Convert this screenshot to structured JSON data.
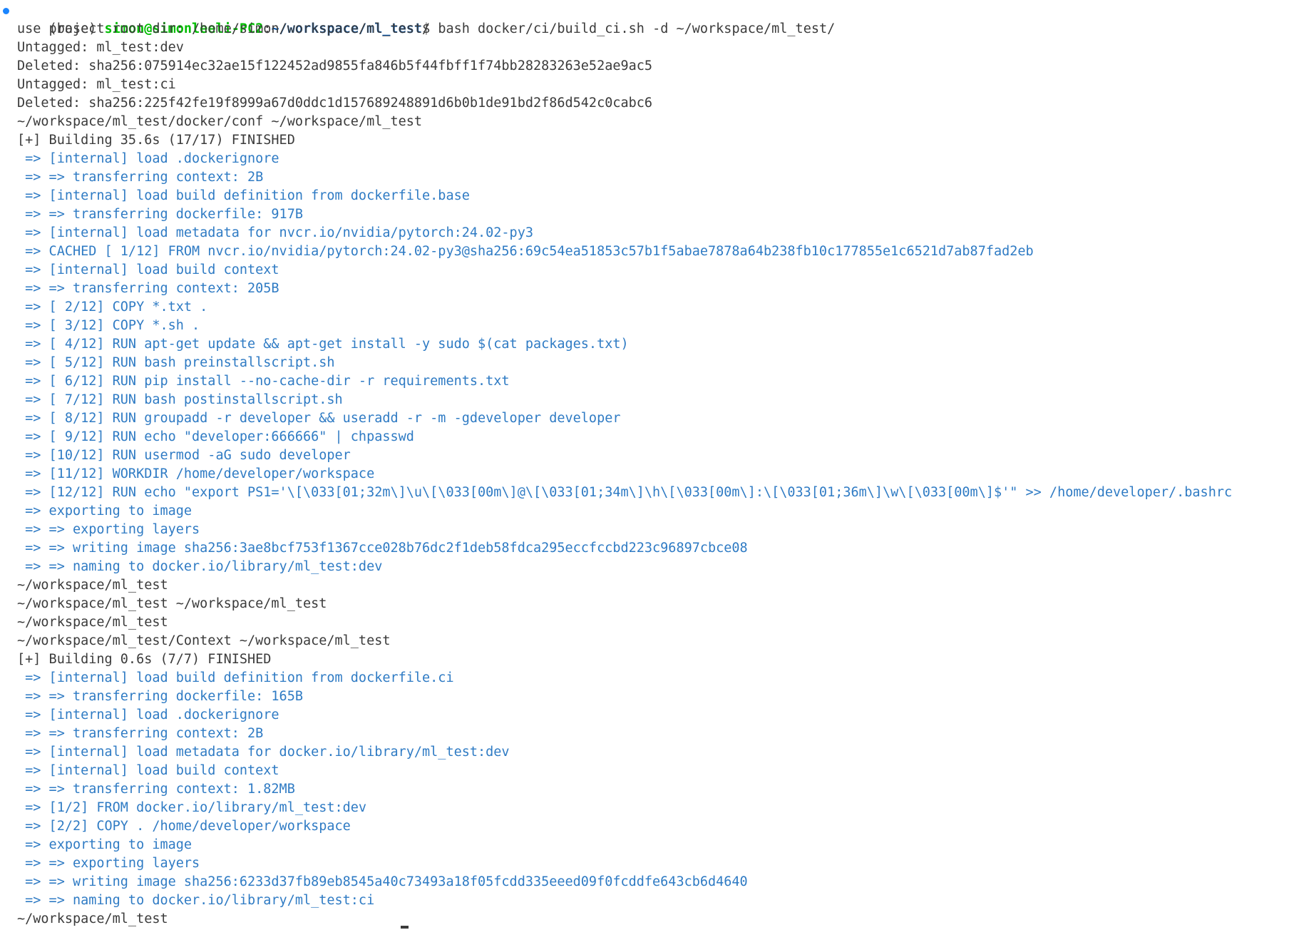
{
  "prompt": {
    "env": "(base) ",
    "user_host": "simon@simonleeli-PC2",
    "sep": ":",
    "cwd": "~/workspace/ml_test",
    "sigil": "$ ",
    "command": "bash docker/ci/build_ci.sh -d ~/workspace/ml_test/"
  },
  "output": {
    "l01": "use project root dir: /home/simon/workspace/ml_test/",
    "l02": "Untagged: ml_test:dev",
    "l03": "Deleted: sha256:075914ec32ae15f122452ad9855fa846b5f44fbff1f74bb28283263e52ae9ac5",
    "l04": "Untagged: ml_test:ci",
    "l05": "Deleted: sha256:225f42fe19f8999a67d0ddc1d157689248891d6b0b1de91bd2f86d542c0cabc6",
    "l06": "~/workspace/ml_test/docker/conf ~/workspace/ml_test",
    "l07": "[+] Building 35.6s (17/17) FINISHED",
    "b01": " => [internal] load .dockerignore",
    "b02": " => => transferring context: 2B",
    "b03": " => [internal] load build definition from dockerfile.base",
    "b04": " => => transferring dockerfile: 917B",
    "b05": " => [internal] load metadata for nvcr.io/nvidia/pytorch:24.02-py3",
    "b06": " => CACHED [ 1/12] FROM nvcr.io/nvidia/pytorch:24.02-py3@sha256:69c54ea51853c57b1f5abae7878a64b238fb10c177855e1c6521d7ab87fad2eb",
    "b07": " => [internal] load build context",
    "b08": " => => transferring context: 205B",
    "b09": " => [ 2/12] COPY *.txt .",
    "b10": " => [ 3/12] COPY *.sh .",
    "b11": " => [ 4/12] RUN apt-get update && apt-get install -y sudo $(cat packages.txt)",
    "b12": " => [ 5/12] RUN bash preinstallscript.sh",
    "b13": " => [ 6/12] RUN pip install --no-cache-dir -r requirements.txt",
    "b14": " => [ 7/12] RUN bash postinstallscript.sh",
    "b15": " => [ 8/12] RUN groupadd -r developer && useradd -r -m -gdeveloper developer",
    "b16": " => [ 9/12] RUN echo \"developer:666666\" | chpasswd",
    "b17": " => [10/12] RUN usermod -aG sudo developer",
    "b18": " => [11/12] WORKDIR /home/developer/workspace",
    "b19": " => [12/12] RUN echo \"export PS1='\\[\\033[01;32m\\]\\u\\[\\033[00m\\]@\\[\\033[01;34m\\]\\h\\[\\033[00m\\]:\\[\\033[01;36m\\]\\w\\[\\033[00m\\]$'\" >> /home/developer/.bashrc",
    "b20": " => exporting to image",
    "b21": " => => exporting layers",
    "b22": " => => writing image sha256:3ae8bcf753f1367cce028b76dc2f1deb58fdca295eccfccbd223c96897cbce08",
    "b23": " => => naming to docker.io/library/ml_test:dev",
    "l08": "~/workspace/ml_test",
    "l09": "~/workspace/ml_test ~/workspace/ml_test",
    "l10": "~/workspace/ml_test",
    "l11": "~/workspace/ml_test/Context ~/workspace/ml_test",
    "l12": "[+] Building 0.6s (7/7) FINISHED",
    "c01": " => [internal] load build definition from dockerfile.ci",
    "c02": " => => transferring dockerfile: 165B",
    "c03": " => [internal] load .dockerignore",
    "c04": " => => transferring context: 2B",
    "c05": " => [internal] load metadata for docker.io/library/ml_test:dev",
    "c06": " => [internal] load build context",
    "c07": " => => transferring context: 1.82MB",
    "c08": " => [1/2] FROM docker.io/library/ml_test:dev",
    "c09": " => [2/2] COPY . /home/developer/workspace",
    "c10": " => exporting to image",
    "c11": " => => exporting layers",
    "c12": " => => writing image sha256:6233d37fb89eb8545a40c73493a18f05fcdd335eeed09f0fcddfe643cb6d4640",
    "c13": " => => naming to docker.io/library/ml_test:ci",
    "l13": "~/workspace/ml_test"
  },
  "colors": {
    "background": "#ffffff",
    "text": "#3b3b3b",
    "user": "#00bc00",
    "path": "#0451a5",
    "build_step": "#2f7bc4",
    "prompt_dot": "#1a85ff"
  }
}
